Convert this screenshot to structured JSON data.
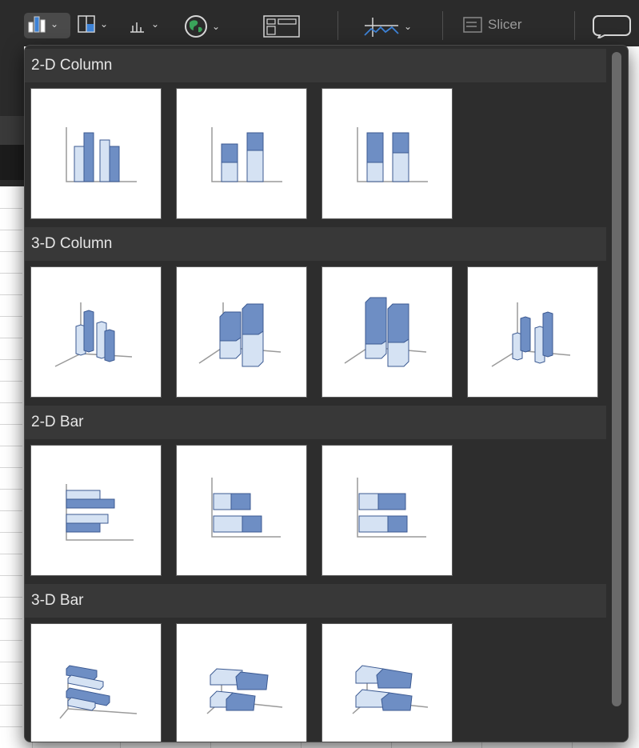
{
  "toolbar": {
    "slicer_label": "Slicer",
    "icons": [
      "column-chart-icon",
      "hierarchy-chart-icon",
      "statistic-chart-icon",
      "map-chart-icon",
      "pivot-chart-icon",
      "sparkline-icon",
      "slicer-icon",
      "comment-icon"
    ]
  },
  "sections": [
    {
      "title": "2-D Column",
      "items": [
        "Clustered Column",
        "Stacked Column",
        "100% Stacked Column"
      ]
    },
    {
      "title": "3-D Column",
      "items": [
        "3-D Clustered Column",
        "3-D Stacked Column",
        "3-D 100% Stacked Column",
        "3-D Column"
      ]
    },
    {
      "title": "2-D Bar",
      "items": [
        "Clustered Bar",
        "Stacked Bar",
        "100% Stacked Bar"
      ]
    },
    {
      "title": "3-D Bar",
      "items": [
        "3-D Clustered Bar",
        "3-D Stacked Bar",
        "3-D 100% Stacked Bar"
      ]
    }
  ],
  "colors": {
    "series_dark": "#6e8ec4",
    "series_light": "#d5e2f3",
    "outline": "#3c5a92",
    "panel_bg": "#2d2d2d",
    "header_bg": "#383838"
  }
}
